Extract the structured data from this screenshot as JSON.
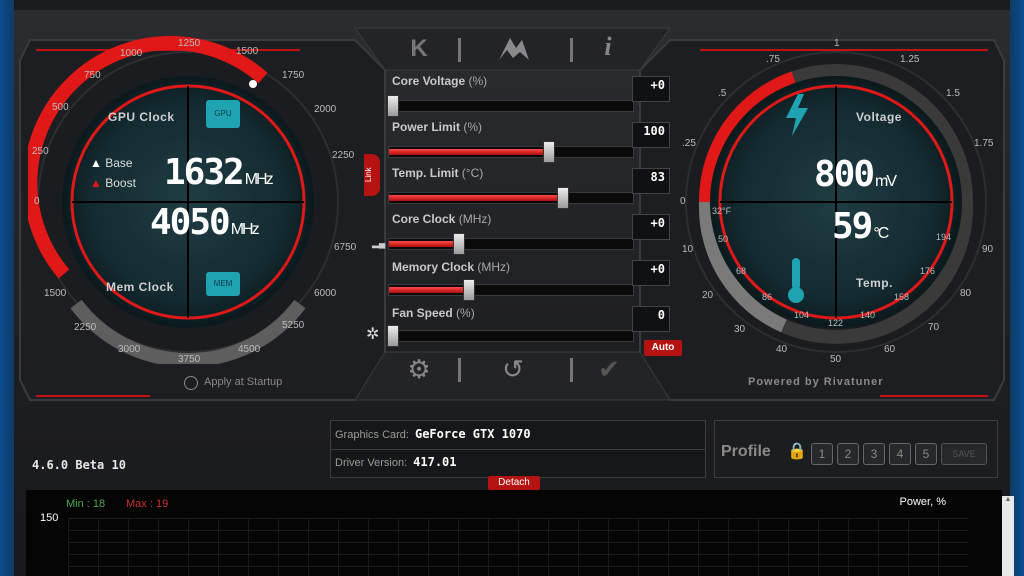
{
  "toolbar": {
    "k_label": "K",
    "info_label": "i"
  },
  "left_gauge": {
    "gpu_clock_label": "GPU Clock",
    "gpu_chip": "GPU",
    "base_label": "Base",
    "boost_label": "Boost",
    "gpu_clock_value": "1632",
    "gpu_clock_unit": "MHz",
    "mem_clock_value": "4050",
    "mem_clock_unit": "MHz",
    "mem_clock_label": "Mem Clock",
    "mem_chip": "MEM",
    "scale_outer": [
      "0",
      "250",
      "500",
      "750",
      "1000",
      "1250",
      "1500",
      "1750",
      "2000",
      "2250"
    ],
    "scale_inner": [
      "1500",
      "2250",
      "3000",
      "3750",
      "4500",
      "5250",
      "6000",
      "6750"
    ],
    "apply_startup": "Apply at Startup"
  },
  "link_label": "Link",
  "sliders": [
    {
      "label": "Core Voltage",
      "unit": "(%)",
      "value": "+0",
      "fill": 0.0
    },
    {
      "label": "Power Limit",
      "unit": "(%)",
      "value": "100",
      "fill": 0.65
    },
    {
      "label": "Temp. Limit",
      "unit": "(°C)",
      "value": "83",
      "fill": 0.71
    },
    {
      "label": "Core Clock",
      "unit": "(MHz)",
      "value": "+0",
      "fill": 0.28
    },
    {
      "label": "Memory Clock",
      "unit": "(MHz)",
      "value": "+0",
      "fill": 0.32
    },
    {
      "label": "Fan Speed",
      "unit": "(%)",
      "value": "0",
      "fill": 0.0
    }
  ],
  "fan_auto": "Auto",
  "right_gauge": {
    "voltage_label": "Voltage",
    "voltage_value": "800",
    "voltage_unit": "mV",
    "temp_value": "59",
    "temp_unit": "°C",
    "temp_label": "Temp.",
    "scale_outer": [
      "0",
      ".25",
      ".5",
      ".75",
      "1",
      "1.25",
      "1.5",
      "1.75"
    ],
    "scale_inner_c": [
      "32°F",
      "50",
      "68",
      "86",
      "104",
      "122",
      "140",
      "158",
      "176",
      "194"
    ],
    "scale_outer_f": [
      "10",
      "20",
      "30",
      "40",
      "50",
      "60",
      "70",
      "80",
      "90"
    ],
    "powered_by": "Powered by Rivatuner"
  },
  "version": "4.6.0 Beta 10",
  "info": {
    "graphics_card_key": "Graphics Card:",
    "graphics_card_val": "GeForce GTX 1070",
    "driver_key": "Driver Version:",
    "driver_val": "417.01",
    "detach": "Detach"
  },
  "profile": {
    "label": "Profile",
    "slots": [
      "1",
      "2",
      "3",
      "4",
      "5"
    ],
    "save": "SAVE"
  },
  "monitor": {
    "min_label": "Min : 18",
    "max_label": "Max : 19",
    "axis_top": "150",
    "series_label": "Power, %"
  },
  "colors": {
    "accent": "#e01818",
    "background": "#1e1f22",
    "text": "#ffffff",
    "teal": "#1fa3b3"
  }
}
